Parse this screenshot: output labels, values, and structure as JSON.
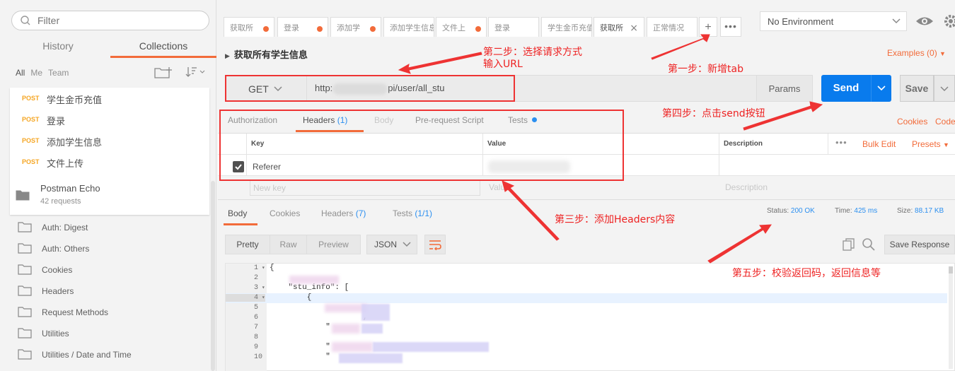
{
  "sidebar": {
    "filter_placeholder": "Filter",
    "tabs": {
      "history": "History",
      "collections": "Collections"
    },
    "scope": {
      "all": "All",
      "me": "Me",
      "team": "Team"
    },
    "requests": [
      {
        "method": "POST",
        "name": "学生金币充值"
      },
      {
        "method": "POST",
        "name": "登录"
      },
      {
        "method": "POST",
        "name": "添加学生信息"
      },
      {
        "method": "POST",
        "name": "文件上传"
      }
    ],
    "echo": {
      "title": "Postman Echo",
      "subtitle": "42 requests"
    },
    "folders": [
      "Auth: Digest",
      "Auth: Others",
      "Cookies",
      "Headers",
      "Request Methods",
      "Utilities",
      "Utilities / Date and Time"
    ]
  },
  "tabs": [
    {
      "label": "获取所",
      "dot": true
    },
    {
      "label": "登录",
      "dot": true
    },
    {
      "label": "添加学",
      "dot": true
    },
    {
      "label": "添加学生信息",
      "dot": false
    },
    {
      "label": "文件上",
      "dot": true
    },
    {
      "label": "登录",
      "dot": false
    },
    {
      "label": "学生金币充值",
      "dot": false
    },
    {
      "label": "获取所",
      "dot": false,
      "close": "×"
    },
    {
      "label": "正常情况",
      "dot": false
    }
  ],
  "tab_controls": {
    "add": "+",
    "more": "•••"
  },
  "environment": "No Environment",
  "request": {
    "title": "获取所有学生信息",
    "examples": "Examples (0)",
    "method": "GET",
    "url_prefix": "http:",
    "url_suffix": "pi/user/all_stu",
    "params": "Params",
    "send": "Send",
    "save": "Save"
  },
  "req_tabs": {
    "authorization": "Authorization",
    "headers": "Headers",
    "headers_count": "(1)",
    "body": "Body",
    "prerequest": "Pre-request Script",
    "tests": "Tests",
    "cookies": "Cookies",
    "code": "Code"
  },
  "headers_table": {
    "cols": {
      "key": "Key",
      "value": "Value",
      "description": "Description"
    },
    "dots": "•••",
    "bulk_edit": "Bulk Edit",
    "presets": "Presets",
    "row_key": "Referer",
    "new_key": "New key",
    "new_value": "Value",
    "new_desc": "Description"
  },
  "response": {
    "tabs": {
      "body": "Body",
      "cookies": "Cookies",
      "headers": "Headers",
      "headers_count": "(7)",
      "tests": "Tests",
      "tests_count": "(1/1)"
    },
    "status_label": "Status:",
    "status": "200 OK",
    "time_label": "Time:",
    "time": "425 ms",
    "size_label": "Size:",
    "size": "88.17 KB",
    "formats": {
      "pretty": "Pretty",
      "raw": "Raw",
      "preview": "Preview",
      "json": "JSON"
    },
    "save_response": "Save Response",
    "line_numbers": [
      "1",
      "2",
      "3",
      "4",
      "5",
      "6",
      "7",
      "8",
      "9",
      "10"
    ],
    "code_lines": [
      "{",
      "",
      "    \"stu_info\": [",
      "        {",
      "",
      "                    ,",
      "            \"",
      "",
      "            \"",
      "            \""
    ]
  },
  "annotations": {
    "step1": "第一步：新增tab",
    "step2_line1": "第二步：选择请求方式",
    "step2_line2": "输入URL",
    "step3": "第三步：添加Headers内容",
    "step4": "第四步：点击send按钮",
    "step5": "第五步：校验返回码，返回信息等"
  },
  "colors": {
    "accent": "#f26b3a",
    "send": "#097bed",
    "annotation": "#ee3333",
    "link_blue": "#2b8ff0"
  }
}
